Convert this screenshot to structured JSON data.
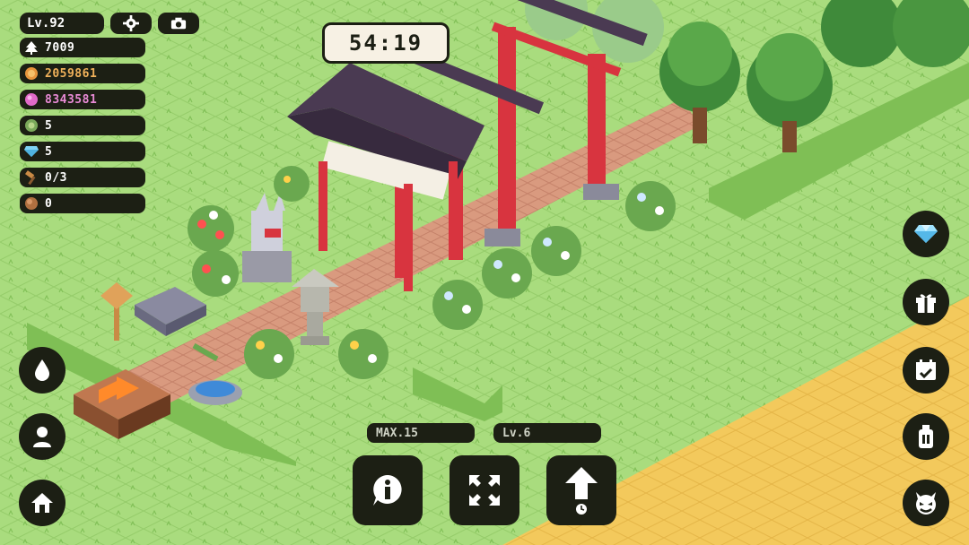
{
  "top_bar": {
    "level_label": "Lv.92",
    "settings_icon": "gear-icon",
    "camera_icon": "camera-icon"
  },
  "timer": {
    "value": "54:19"
  },
  "resources": [
    {
      "icon": "tree-icon",
      "value": "7009",
      "color": "#ffffff"
    },
    {
      "icon": "coin-icon",
      "value": "2059861",
      "color": "#f0b15a"
    },
    {
      "icon": "gem-icon",
      "value": "8343581",
      "color": "#e88ad6"
    },
    {
      "icon": "seed-icon",
      "value": "5",
      "color": "#ffffff"
    },
    {
      "icon": "diamond-icon",
      "value": "5",
      "color": "#ffffff"
    },
    {
      "icon": "hammer-icon",
      "value": "0/3",
      "color": "#ffffff"
    },
    {
      "icon": "acorn-icon",
      "value": "0",
      "color": "#ffffff"
    }
  ],
  "left_menu": [
    {
      "name": "water-drop-button",
      "icon": "water-drop-icon"
    },
    {
      "name": "profile-button",
      "icon": "person-icon"
    },
    {
      "name": "home-button",
      "icon": "house-icon"
    }
  ],
  "right_menu": [
    {
      "name": "diamond-shop-button",
      "icon": "diamond-icon"
    },
    {
      "name": "gift-button",
      "icon": "gift-icon"
    },
    {
      "name": "calendar-button",
      "icon": "calendar-icon"
    },
    {
      "name": "potion-button",
      "icon": "bottle-icon"
    },
    {
      "name": "demon-button",
      "icon": "demon-face-icon"
    }
  ],
  "bottom_panel": {
    "max_label": "MAX.15",
    "level_label": "Lv.6",
    "info_icon": "info-icon",
    "expand_icon": "expand-arrows-icon",
    "upgrade_icon": "upgrade-arrow-icon",
    "upgrade_sub_icon": "clock-icon"
  },
  "colors": {
    "grass": "#a8dc7c",
    "grass_dark": "#7fbf5a",
    "path": "#d9987c",
    "sand": "#f2c85a",
    "torii": "#d8343f",
    "roof": "#4a3a52",
    "ui_dark": "#1c1f14"
  }
}
